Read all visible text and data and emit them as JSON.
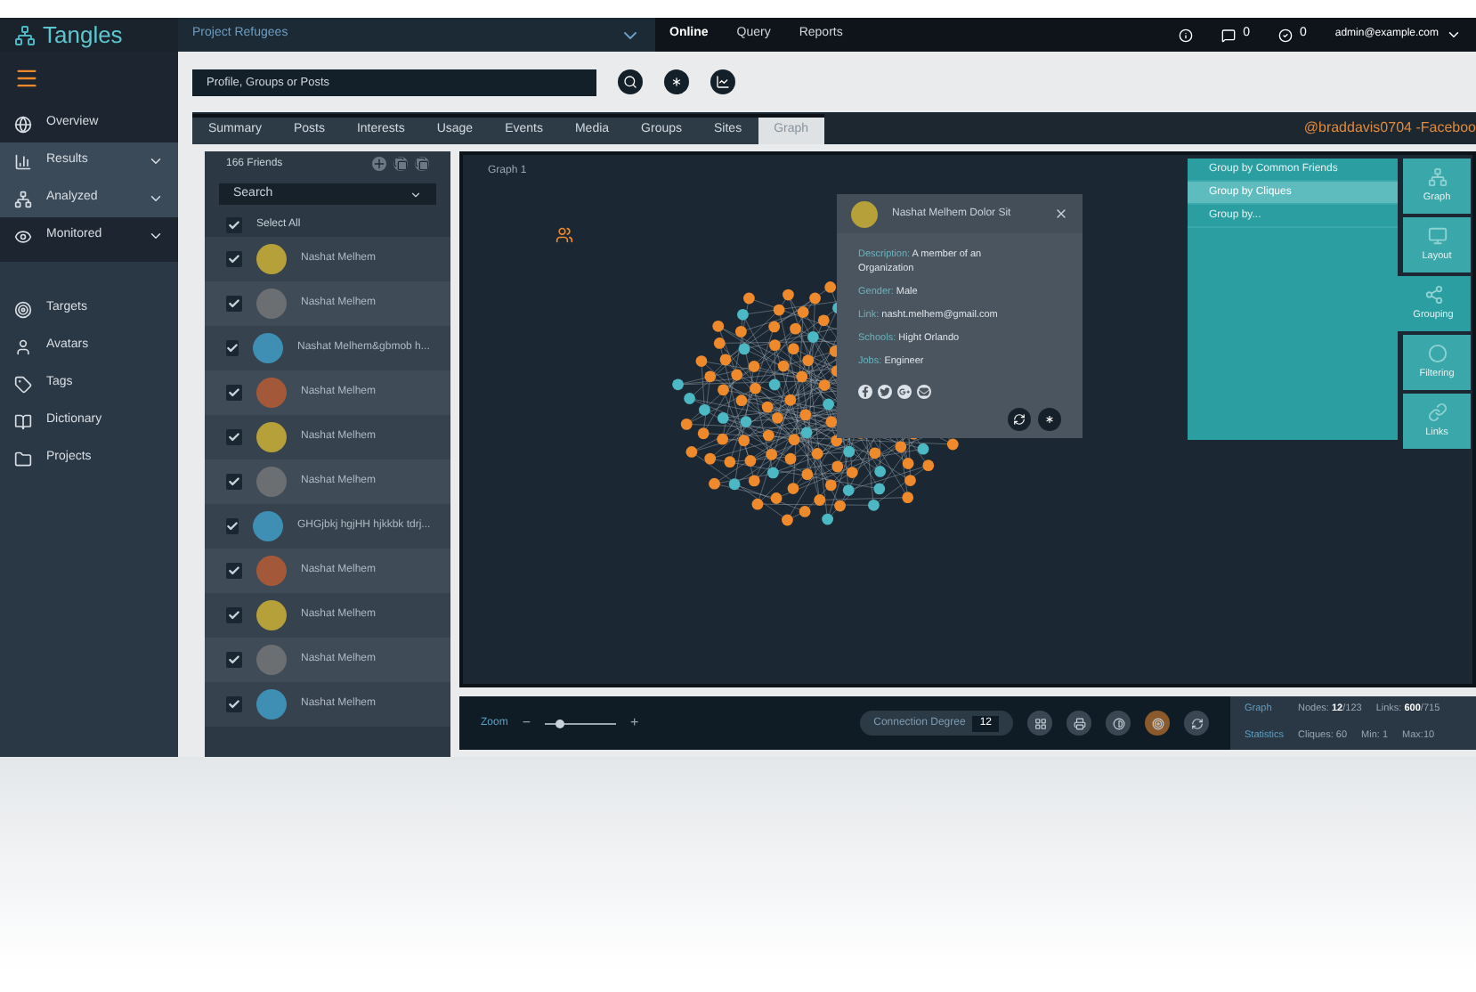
{
  "topbar": {
    "logo": "Tangles",
    "project": "Project Refugees",
    "nav": [
      {
        "label": "Online",
        "selected": true
      },
      {
        "label": "Query",
        "selected": false
      },
      {
        "label": "Reports",
        "selected": false
      }
    ],
    "messages": "0",
    "checks": "0",
    "user": "admin@example.com"
  },
  "sidebar": {
    "items": [
      {
        "label": "Overview",
        "highlighted": false,
        "expandable": false
      },
      {
        "label": "Results",
        "highlighted": true,
        "expandable": true
      },
      {
        "label": "Analyzed",
        "highlighted": true,
        "expandable": true
      },
      {
        "label": "Monitored",
        "highlighted": false,
        "expandable": true
      }
    ],
    "links": [
      {
        "label": "Targets"
      },
      {
        "label": "Avatars"
      },
      {
        "label": "Tags"
      },
      {
        "label": "Dictionary"
      },
      {
        "label": "Projects"
      }
    ]
  },
  "search": {
    "placeholder": "Profile, Groups or Posts"
  },
  "tabs": [
    {
      "label": "Summary",
      "selected": false
    },
    {
      "label": "Posts",
      "selected": false
    },
    {
      "label": "Interests",
      "selected": false
    },
    {
      "label": "Usage",
      "selected": false
    },
    {
      "label": "Events",
      "selected": false
    },
    {
      "label": "Media",
      "selected": false
    },
    {
      "label": "Groups",
      "selected": false
    },
    {
      "label": "Sites",
      "selected": false
    },
    {
      "label": "Graph",
      "selected": true
    }
  ],
  "profile_handle": "@braddavis0704 -Faceboo",
  "friends": {
    "title": "166 Friends",
    "search_placeholder": "Search",
    "select_all": {
      "label": "Select All",
      "checked": true
    },
    "items": [
      {
        "name": "Nashat Melhem",
        "checked": true
      },
      {
        "name": "Nashat Melhem",
        "checked": true
      },
      {
        "name": "Nashat Melhem&gbmob h...",
        "checked": true
      },
      {
        "name": "Nashat Melhem",
        "checked": true
      },
      {
        "name": "Nashat Melhem",
        "checked": true
      },
      {
        "name": "Nashat Melhem",
        "checked": true
      },
      {
        "name": "GHGjbkj hgjHH hjkkbk tdrj...",
        "checked": true
      },
      {
        "name": "Nashat Melhem",
        "checked": true
      },
      {
        "name": "Nashat Melhem",
        "checked": true
      },
      {
        "name": "Nashat Melhem",
        "checked": true
      },
      {
        "name": "Nashat Melhem",
        "checked": true
      }
    ]
  },
  "graph": {
    "title": "Graph 1",
    "popup": {
      "name": "Nashat Melhem Dolor Sit",
      "fields": [
        {
          "label": "Description:",
          "value": "A member of an Organization"
        },
        {
          "label": "Gender:",
          "value": "Male"
        },
        {
          "label": "Link:",
          "value": "nasht.melhem@gmail.com"
        },
        {
          "label": "Schools:",
          "value": "Hight Orlando"
        },
        {
          "label": "Jobs:",
          "value": "Engineer"
        }
      ]
    },
    "group_menu": [
      {
        "label": "Group by Common Friends",
        "selected": false
      },
      {
        "label": "Group by Cliques",
        "selected": true
      },
      {
        "label": "Group by...",
        "selected": false
      }
    ],
    "tools": [
      {
        "label": "Graph",
        "selected": false
      },
      {
        "label": "Layout",
        "selected": false
      },
      {
        "label": "Grouping",
        "selected": true
      },
      {
        "label": "Filtering",
        "selected": false
      },
      {
        "label": "Links",
        "selected": false
      }
    ]
  },
  "bottom_bar": {
    "zoom_label": "Zoom",
    "zoom_minus": "−",
    "zoom_plus": "+",
    "zoom": {
      "level": 0.2
    },
    "degree_label": "Connection Degree",
    "degree_value": "12",
    "stats_labels": [
      "Graph",
      "Statistics"
    ],
    "nodes_label": "Nodes:",
    "nodes_shown": "12",
    "nodes_total": "/123",
    "links_label": "Links:",
    "links_shown": "600",
    "links_total": "/715",
    "cliques": "Cliques: 60",
    "min": "Min: 1",
    "max": "Max:10"
  }
}
